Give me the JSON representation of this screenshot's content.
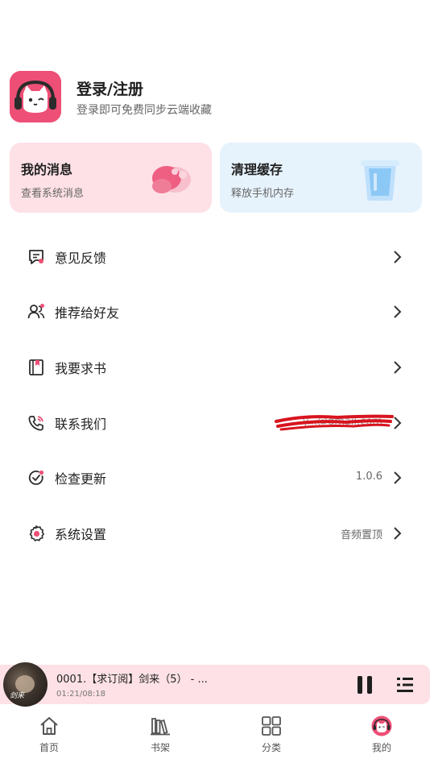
{
  "profile": {
    "title": "登录/注册",
    "subtitle": "登录即可免费同步云端收藏"
  },
  "cards": {
    "messages": {
      "title": "我的消息",
      "subtitle": "查看系统消息"
    },
    "cache": {
      "title": "清理缓存",
      "subtitle": "释放手机内存"
    }
  },
  "menu": {
    "feedback": {
      "label": "意见反馈",
      "icon": "feedback-icon"
    },
    "recommend": {
      "label": "推荐给好友",
      "icon": "share-friends-icon"
    },
    "request_book": {
      "label": "我要求书",
      "icon": "book-icon"
    },
    "contact": {
      "label": "联系我们",
      "value": "y...@gmail.com",
      "icon": "phone-icon"
    },
    "update": {
      "label": "检查更新",
      "value": "1.0.6",
      "icon": "check-update-icon"
    },
    "settings": {
      "label": "系统设置",
      "value": "音频置顶",
      "icon": "settings-gear-icon"
    }
  },
  "player": {
    "track_title": "0001.【求订阅】剑来（5） - ...",
    "time": "01:21/08:18",
    "cover_text": "剑来"
  },
  "nav": {
    "home": "首页",
    "bookshelf": "书架",
    "category": "分类",
    "mine": "我的"
  },
  "colors": {
    "accent": "#ee4f76",
    "message_card_bg": "#fde1e6",
    "cache_card_bg": "#e6f2fc",
    "player_bg": "#fde1e6",
    "redaction": "#d8141e"
  }
}
